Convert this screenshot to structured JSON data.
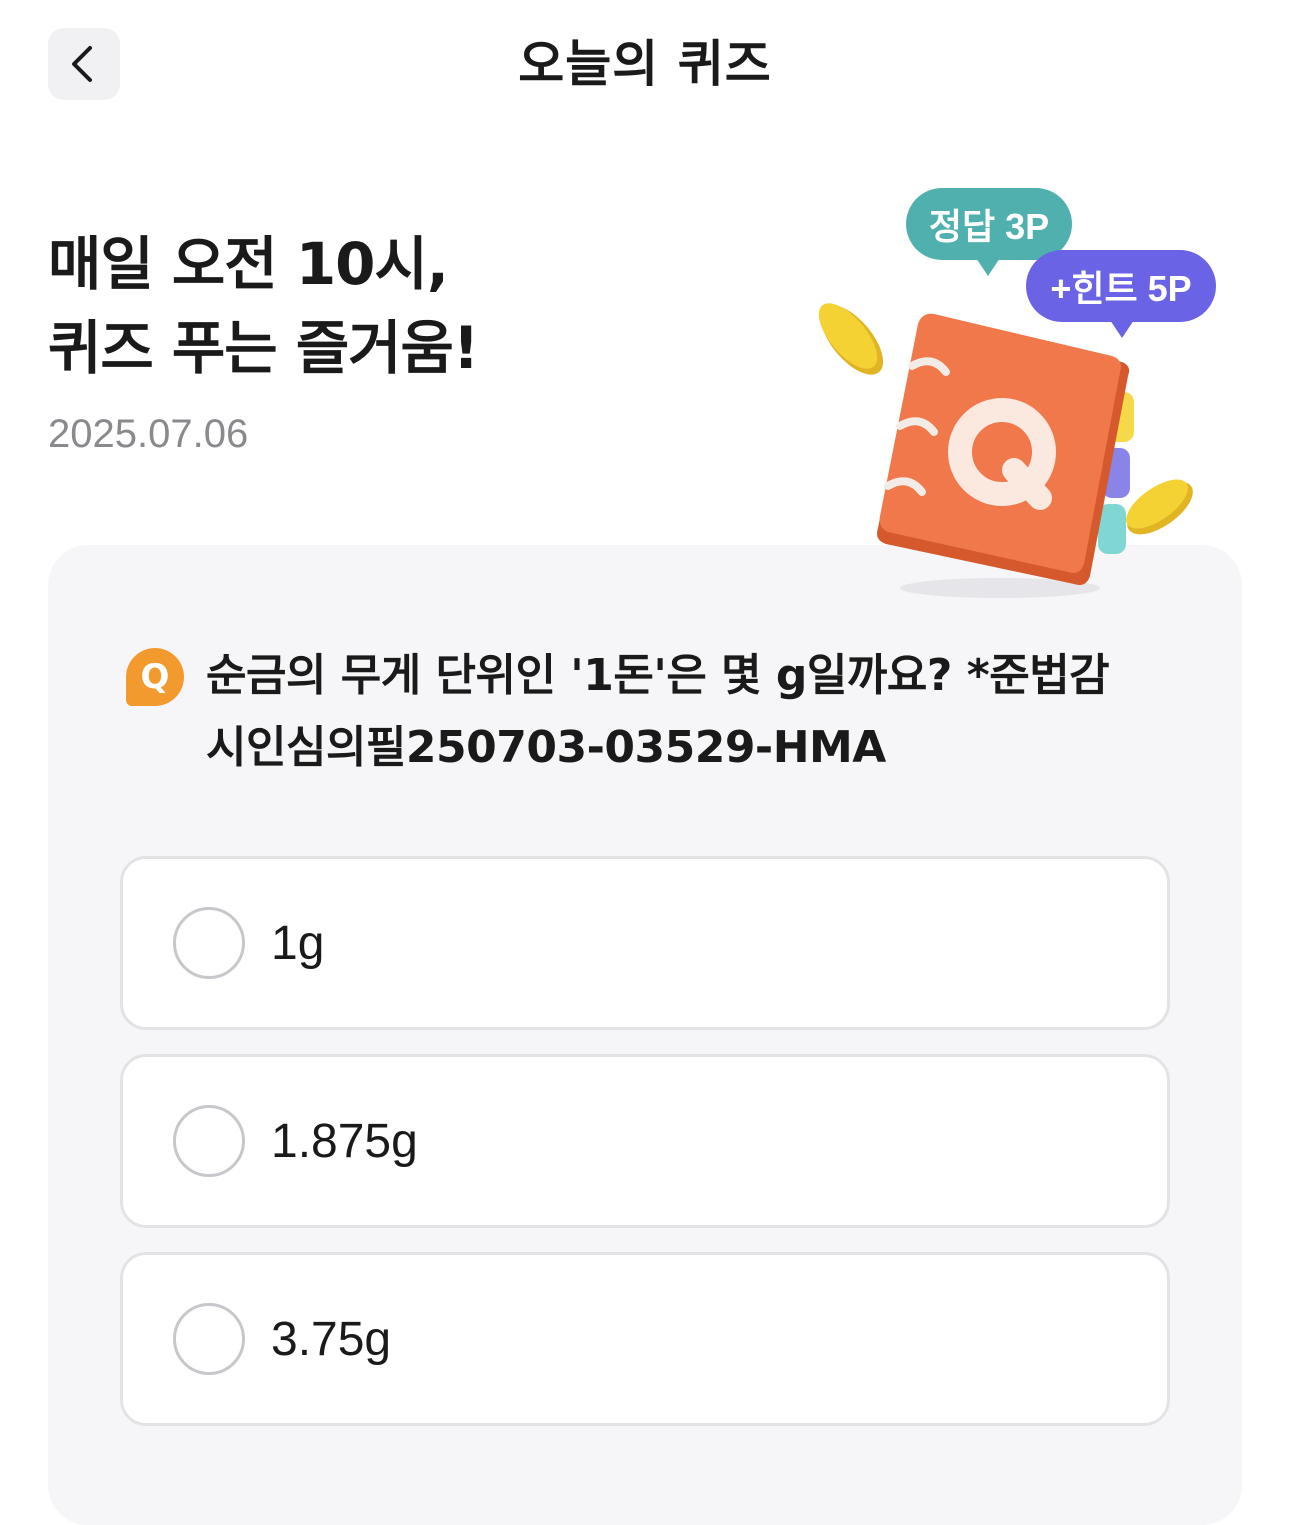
{
  "header": {
    "title": "오늘의 퀴즈",
    "back_icon": "chevron-left-icon"
  },
  "hero": {
    "headline_line1": "매일 오전 10시,",
    "headline_line2": "퀴즈 푸는 즐거움!",
    "date": "2025.07.06"
  },
  "rewards": {
    "answer_badge": "정답 3P",
    "hint_badge": "+힌트 5P",
    "answer_color": "#4fb0ad",
    "hint_color": "#6b63e6"
  },
  "illustration": {
    "icon": "quiz-notebook-icon",
    "letter": "Q",
    "book_color": "#f0784a",
    "coin_color": "#f4d233"
  },
  "quiz": {
    "badge": "Q",
    "badge_color": "#f39a2f",
    "question_line1": "순금의 무게 단위인 '1돈'은 몇 g일까요? *준법감",
    "question_line2": "시인심의필250703-03529-HMA",
    "options": [
      {
        "label": "1g"
      },
      {
        "label": "1.875g"
      },
      {
        "label": "3.75g"
      }
    ]
  }
}
